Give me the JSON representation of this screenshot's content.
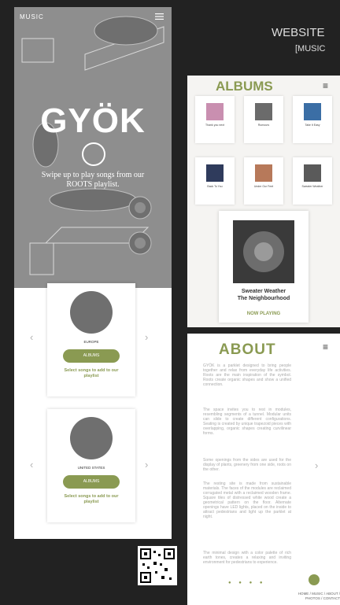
{
  "left_phone": {
    "header_label": "MUSIC",
    "brand": "GYÖK",
    "swipe_text": "Swipe up to play songs from our ROOTS playlist.",
    "regions": [
      {
        "name": "EUROPE",
        "button": "ALBUMS",
        "hint": "Select songs to add to our playlist"
      },
      {
        "name": "UNITED STATES",
        "button": "ALBUMS",
        "hint": "Select songs to add to our playlist"
      }
    ]
  },
  "right_labels": {
    "website": "WEBSITE",
    "music": "[MUSIC"
  },
  "albums_page": {
    "title": "ALBUMS",
    "thumbnails": [
      {
        "title": "Thank you next"
      },
      {
        "title": "Rumours"
      },
      {
        "title": "Take It Easy"
      },
      {
        "title": "Back To You"
      },
      {
        "title": "Under Our Feet"
      },
      {
        "title": "Sweater Weather"
      }
    ],
    "now_playing": {
      "song": "Sweater Weather",
      "artist": "The Neighbourhood",
      "label": "NOW PLAYING"
    }
  },
  "about_page": {
    "title": "ABOUT",
    "paragraphs": [
      "GYÖK is a parklet designed to bring people together and relax from everyday life activities. Roots are the main inspiration of the symbol. Roots create organic shapes and show a unified connection.",
      "The space invites you to rest in modules, resembling segments of a tunnel. Modular units can slide to create different configurations. Seating is created by unique trapezoid pieces with overlapping, organic shapes creating curvilinear forms.",
      "Some openings from the sides are used for the display of plants, greenery from one side, roots on the other.",
      "The resting site is made from sustainable materials. The faces of the modules are reclaimed corrugated metal with a reclaimed wooden frame. Square tiles of distressed white wood create a geometrical pattern on the floor. Alternate openings have LED lights, placed on the inside to attract pedestrians and light up the parklet at night.",
      "The minimal design with a color palette of rich earth tones, creates a relaxing and inviting environment for pedestrians to experience."
    ],
    "footer": "HOME / MUSIC / ABOUT / PHOTOS / CONTACT"
  },
  "colors": {
    "accent": "#8a9a52",
    "hero_overlay": "#8e8e8e",
    "background": "#222222"
  }
}
